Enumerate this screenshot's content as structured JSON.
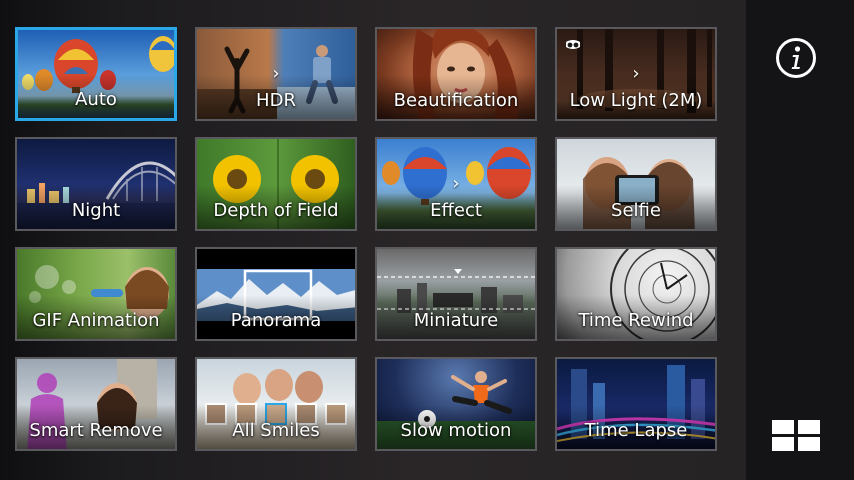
{
  "modes": [
    {
      "id": "auto",
      "label": "Auto",
      "selected": true
    },
    {
      "id": "hdr",
      "label": "HDR",
      "selected": false
    },
    {
      "id": "beautification",
      "label": "Beautification",
      "selected": false
    },
    {
      "id": "low-light",
      "label": "Low Light (2M)",
      "selected": false
    },
    {
      "id": "night",
      "label": "Night",
      "selected": false
    },
    {
      "id": "depth-of-field",
      "label": "Depth of Field",
      "selected": false
    },
    {
      "id": "effect",
      "label": "Effect",
      "selected": false
    },
    {
      "id": "selfie",
      "label": "Selfie",
      "selected": false
    },
    {
      "id": "gif-animation",
      "label": "GIF Animation",
      "selected": false
    },
    {
      "id": "panorama",
      "label": "Panorama",
      "selected": false
    },
    {
      "id": "miniature",
      "label": "Miniature",
      "selected": false
    },
    {
      "id": "time-rewind",
      "label": "Time Rewind",
      "selected": false
    },
    {
      "id": "smart-remove",
      "label": "Smart Remove",
      "selected": false
    },
    {
      "id": "all-smiles",
      "label": "All Smiles",
      "selected": false
    },
    {
      "id": "slow-motion",
      "label": "Slow motion",
      "selected": false
    },
    {
      "id": "time-lapse",
      "label": "Time Lapse",
      "selected": false
    }
  ],
  "icons": {
    "info": "info-circle-icon",
    "grid_view": "grid-view-icon",
    "arrow": "chevron-right-icon",
    "owl": "owl-icon"
  },
  "colors": {
    "selected_border": "#2aa7e6",
    "tile_border": "#5a5a5e",
    "label_text": "#ffffff"
  }
}
